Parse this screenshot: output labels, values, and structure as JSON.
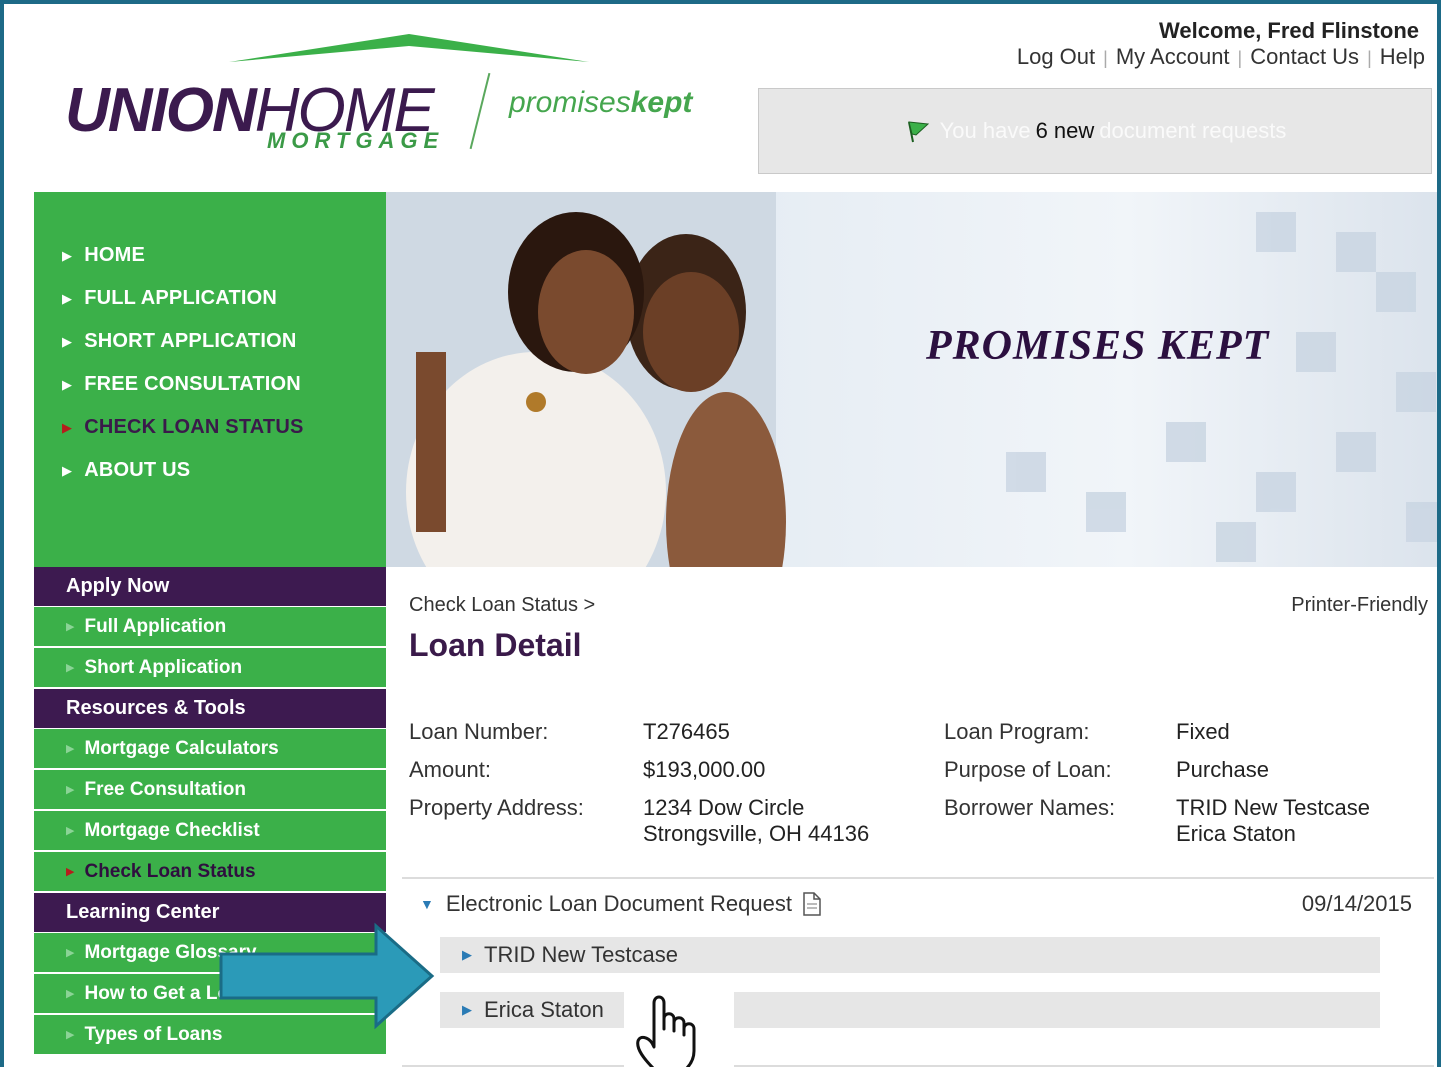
{
  "brand": {
    "name_bold": "UNION",
    "name_light": "HOME",
    "sub": "MORTGAGE",
    "tagline_light": "promises",
    "tagline_bold": "kept",
    "green": "#3bb049",
    "purple": "#3d1a50"
  },
  "header": {
    "welcome": "Welcome, Fred Flinstone",
    "links": [
      "Log Out",
      "My Account",
      "Contact Us",
      "Help"
    ],
    "notification": {
      "prefix": "You have",
      "count": "6 new",
      "suffix": "document requests"
    }
  },
  "main_nav": [
    {
      "label": "HOME",
      "active": false
    },
    {
      "label": "FULL APPLICATION",
      "active": false
    },
    {
      "label": "SHORT APPLICATION",
      "active": false
    },
    {
      "label": "FREE CONSULTATION",
      "active": false
    },
    {
      "label": "CHECK LOAN STATUS",
      "active": true
    },
    {
      "label": "ABOUT US",
      "active": false
    }
  ],
  "hero": {
    "tagline": "PROMISES KEPT"
  },
  "sidebar": {
    "apply_now": {
      "heading": "Apply Now",
      "items": [
        "Full Application",
        "Short Application"
      ]
    },
    "resources": {
      "heading": "Resources & Tools",
      "items": [
        "Mortgage Calculators",
        "Free Consultation",
        "Mortgage Checklist",
        "Check Loan Status"
      ]
    },
    "learning": {
      "heading": "Learning Center",
      "items": [
        "Mortgage Glossary",
        "How to Get a Loan",
        "Types of Loans"
      ]
    }
  },
  "content": {
    "breadcrumb": "Check Loan Status >",
    "printer_friendly": "Printer-Friendly",
    "title": "Loan Detail",
    "details": {
      "loan_number_label": "Loan Number:",
      "loan_number": "T276465",
      "amount_label": "Amount:",
      "amount": "$193,000.00",
      "address_label": "Property Address:",
      "address_line1": "1234 Dow Circle",
      "address_line2": "Strongsville, OH 44136",
      "program_label": "Loan Program:",
      "program": "Fixed",
      "purpose_label": "Purpose of Loan:",
      "purpose": "Purchase",
      "borrowers_label": "Borrower Names:",
      "borrower1": "TRID New Testcase",
      "borrower2": "Erica Staton"
    },
    "doc_request": {
      "title": "Electronic Loan Document Request",
      "date": "09/14/2015",
      "rows": [
        "TRID New Testcase",
        "Erica Staton"
      ]
    }
  }
}
